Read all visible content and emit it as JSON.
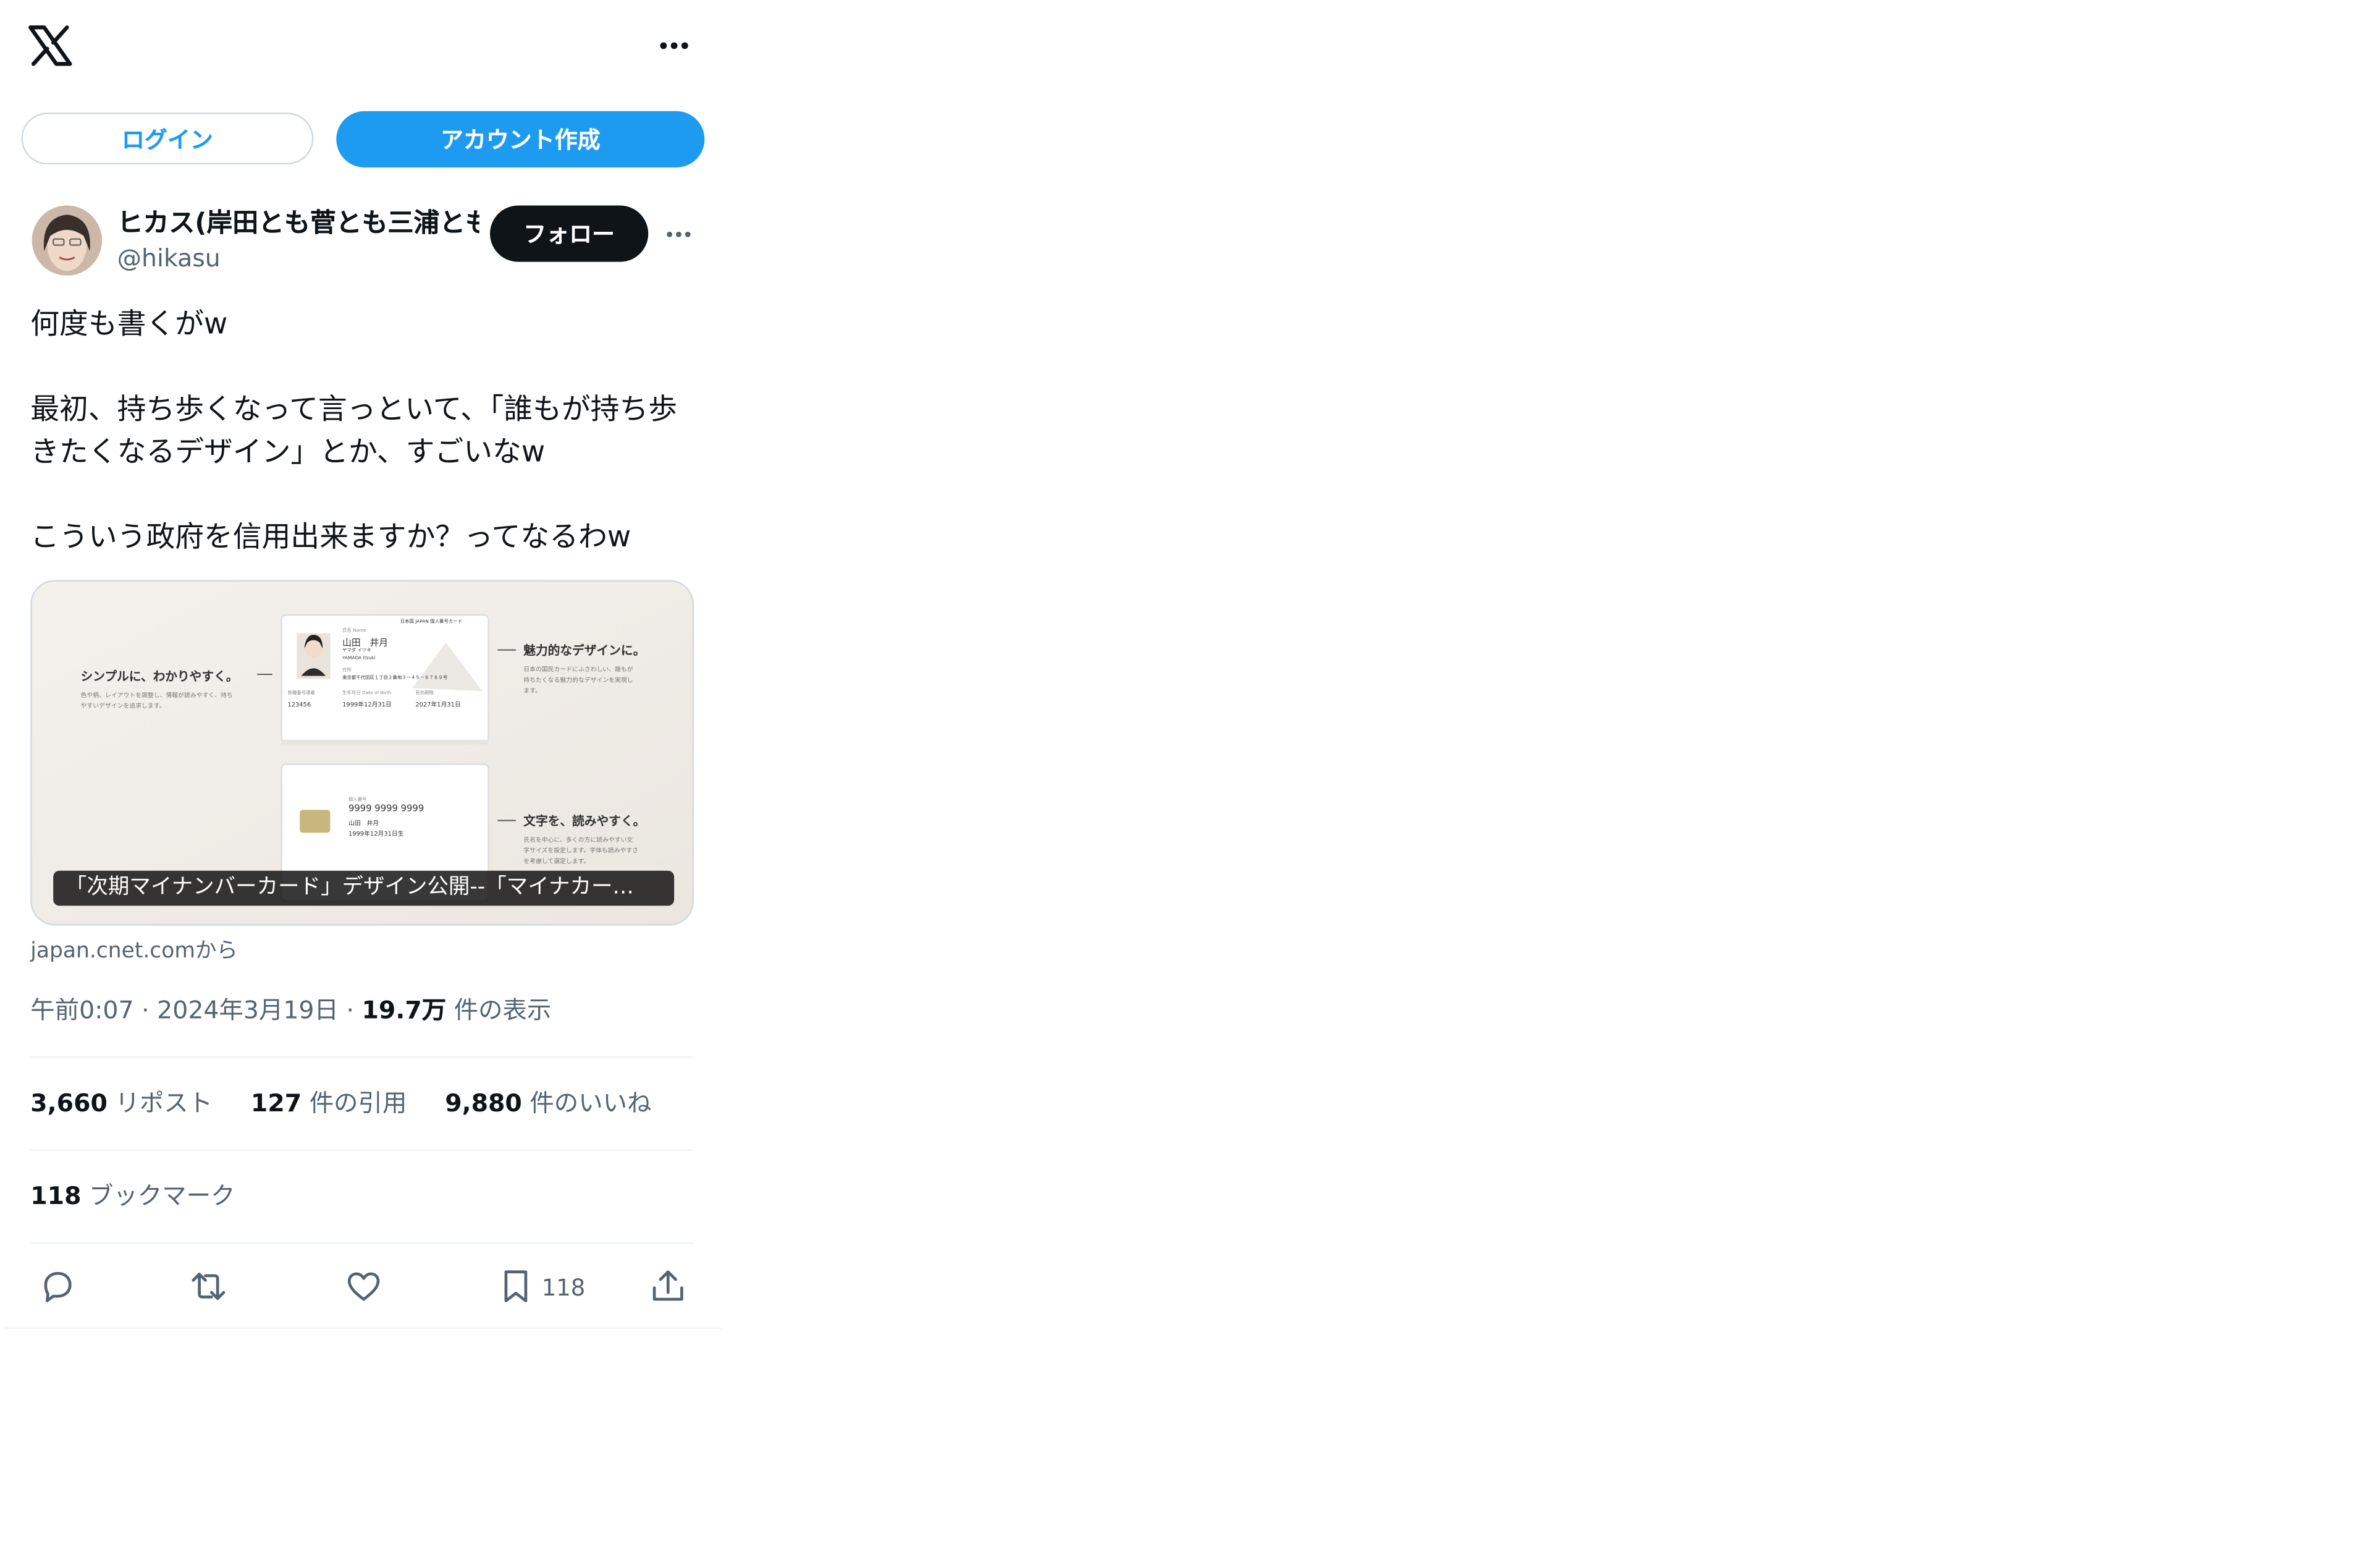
{
  "header": {
    "logo_icon": "x-logo-icon",
    "more_icon": "more-horizontal-icon"
  },
  "auth": {
    "login_label": "ログイン",
    "signup_label": "アカウント作成"
  },
  "post": {
    "author": {
      "display_name": "ヒカス(岸田とも菅とも三浦とも",
      "handle": "@hikasu"
    },
    "follow_label": "フォロー",
    "text": "何度も書くがw\n\n最初、持ち歩くなって言っといて、「誰もが持ち歩きたくなるデザイン」とか、すごいなw\n\nこういう政府を信用出来ますか？ってなるわw",
    "card": {
      "caption": "「次期マイナンバーカード」デザイン公開--「マイナカー…",
      "source": "japan.cnet.comから",
      "image": {
        "left_title": "シンプルに、わかりやすく。",
        "left_body": "色や柄、レイアウトを調整し、情報が読みやすく、持ち",
        "left_body2": "やすいデザインを追求します。",
        "right_title_1": "魅力的なデザインに。",
        "right_body_1": "日本の国民カードにふさわしい、誰もが",
        "right_body_1b": "持ちたくなる魅力的なデザインを実現し",
        "right_body_1c": "ます。",
        "right_title_2": "文字を、読みやすく。",
        "right_body_2": "氏名を中心に、多くの方に読みやすい文",
        "right_body_2b": "字サイズを設定します。字体も読みやすさ",
        "right_body_2c": "を考慮して選定します。",
        "card_header": "日本国 JAPAN 個人番号カード",
        "card_name_label": "氏名 Name",
        "card_name": "山田　井月",
        "card_kana": "ヤマダ イツキ",
        "card_romaji": "YAMADA Itsuki",
        "card_address_label": "住所",
        "card_address": "東京都千代田区１丁目２番地３－４５－６７８９号",
        "card_id_label": "券種番号通番",
        "card_id": "123456",
        "card_dob_label": "生年月日 Date of Birth",
        "card_dob": "1999年12月31日",
        "card_expiry_label": "有効期限",
        "card_expiry": "2027年1月31日",
        "back_number_label": "個人番号",
        "back_number": "9999 9999 9999",
        "back_name": "山田　井月",
        "back_dob": "1999年12月31日生"
      }
    },
    "time": "午前0:07",
    "date": "2024年3月19日",
    "views_count": "19.7万",
    "views_label": "件の表示",
    "reposts_count": "3,660",
    "reposts_label": "リポスト",
    "quotes_count": "127",
    "quotes_label": "件の引用",
    "likes_count": "9,880",
    "likes_label": "件のいいね",
    "bookmarks_count": "118",
    "bookmarks_label": "ブックマーク",
    "actions": {
      "bookmark_count": "118",
      "icons": [
        "reply-icon",
        "repost-icon",
        "like-icon",
        "bookmark-icon",
        "share-icon"
      ]
    }
  },
  "colors": {
    "accent": "#1d9bf0",
    "text": "#0f1419",
    "secondary": "#536471",
    "border": "#cfd9de"
  }
}
